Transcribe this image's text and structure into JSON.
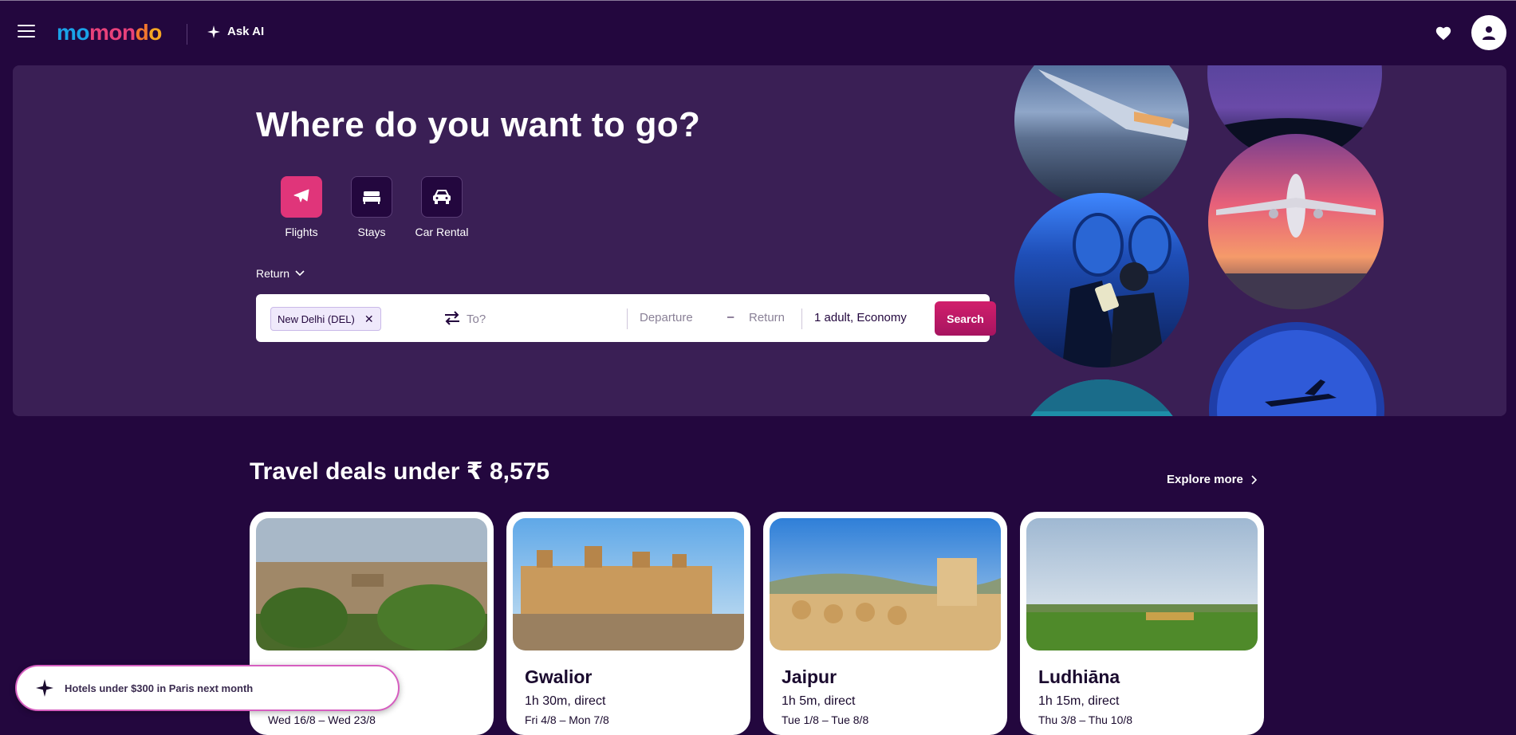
{
  "header": {
    "logo": {
      "m1": "mo",
      "m2": "mo",
      "m3": "n",
      "m4": "d",
      "m5": "o"
    },
    "ask_ai_label": "Ask AI",
    "icons": [
      "menu-icon",
      "sparkle-icon",
      "heart-icon",
      "user-icon"
    ]
  },
  "hero": {
    "title": "Where do you want to go?",
    "verticals": [
      {
        "label": "Flights",
        "icon": "plane-icon",
        "active": true
      },
      {
        "label": "Stays",
        "icon": "bed-icon",
        "active": false
      },
      {
        "label": "Car Rental",
        "icon": "car-icon",
        "active": false
      }
    ],
    "trip_type": "Return",
    "search": {
      "origin": "New Delhi (DEL)",
      "destination_placeholder": "To?",
      "departure_placeholder": "Departure",
      "dash": "–",
      "return_placeholder": "Return",
      "travelers": "1 adult, Economy",
      "search_label": "Search"
    }
  },
  "deals": {
    "title": "Travel deals under ₹ 8,575",
    "explore_label": "Explore more",
    "cards": [
      {
        "city": "",
        "info": "",
        "dates": "Wed 16/8 – Wed 23/8"
      },
      {
        "city": "Gwalior",
        "info": "1h 30m, direct",
        "dates": "Fri 4/8 – Mon 7/8"
      },
      {
        "city": "Jaipur",
        "info": "1h 5m, direct",
        "dates": "Tue 1/8 – Tue 8/8"
      },
      {
        "city": "Ludhiāna",
        "info": "1h 15m, direct",
        "dates": "Thu 3/8 – Thu 10/8"
      }
    ]
  },
  "ai_prompt": {
    "text": "Hotels under $300 in Paris next month"
  },
  "colors": {
    "background": "#23073e",
    "hero": "#3a1f55",
    "accent": "#e0357a",
    "search_button": "#c2186b"
  }
}
